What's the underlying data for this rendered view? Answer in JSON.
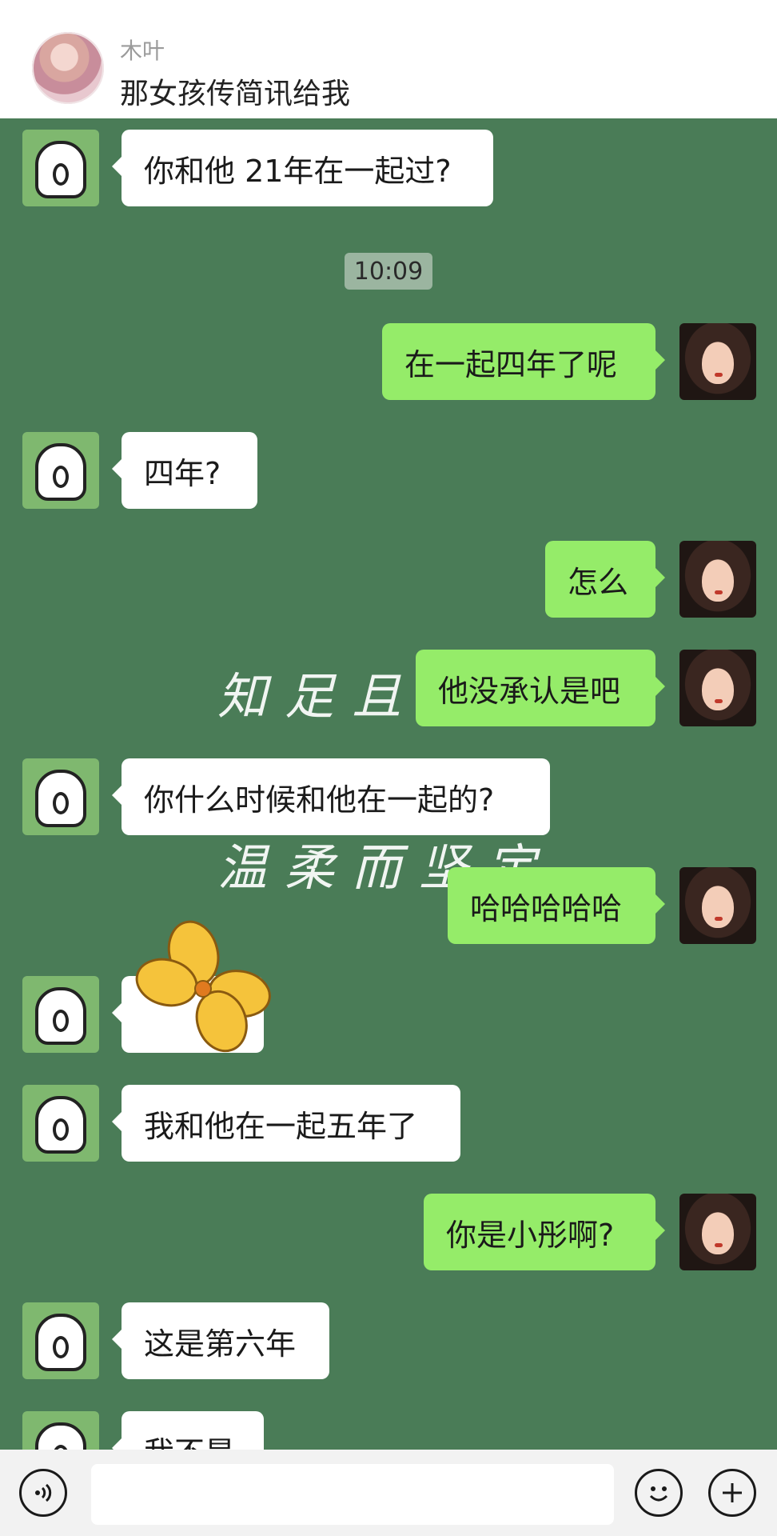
{
  "header": {
    "name": "木叶",
    "title": "那女孩传简讯给我"
  },
  "watermark": {
    "line1": "知足且",
    "line2": "温柔而坚定"
  },
  "timestamp": "10:09",
  "messages": [
    {
      "side": "left",
      "text": "你和他 21年在一起过?"
    },
    {
      "side": "right",
      "text": "在一起四年了呢"
    },
    {
      "side": "left",
      "text": "四年?"
    },
    {
      "side": "right",
      "text": "怎么"
    },
    {
      "side": "right",
      "text": "他没承认是吧"
    },
    {
      "side": "left",
      "text": "你什么时候和他在一起的?"
    },
    {
      "side": "right",
      "text": "哈哈哈哈哈"
    },
    {
      "side": "left",
      "text": ""
    },
    {
      "side": "left",
      "text": "我和他在一起五年了"
    },
    {
      "side": "right",
      "text": "你是小彤啊?"
    },
    {
      "side": "left",
      "text": "这是第六年"
    },
    {
      "side": "left",
      "text": "我不是"
    }
  ],
  "input": {
    "value": "",
    "placeholder": ""
  },
  "icons": {
    "voice": "voice-icon",
    "emoji": "emoji-icon",
    "add": "plus-icon"
  },
  "colors": {
    "chat_background": "#4a7c57",
    "my_bubble": "#95ec69",
    "their_bubble": "#ffffff"
  }
}
